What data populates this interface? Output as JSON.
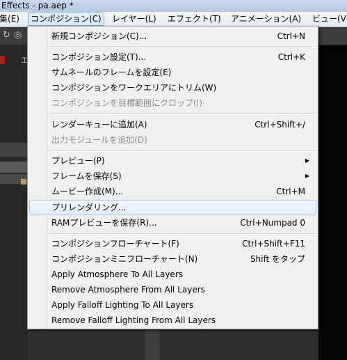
{
  "window": {
    "title": "Effects - pa.aep *"
  },
  "menubar": {
    "items": [
      {
        "label": "編集(E)"
      },
      {
        "label": "コンポジション(C)"
      },
      {
        "label": "レイヤー(L)"
      },
      {
        "label": "エフェクト(T)"
      },
      {
        "label": "アニメーション(A)"
      },
      {
        "label": "ビュー(V)"
      }
    ]
  },
  "background": {
    "panel_tab_label": "エ"
  },
  "menu": {
    "items": [
      {
        "label": "新規コンポジション(C)...",
        "shortcut": "Ctrl+N"
      },
      {
        "label": "コンポジション設定(T)...",
        "shortcut": "Ctrl+K"
      },
      {
        "label": "サムネールのフレームを設定(E)",
        "shortcut": ""
      },
      {
        "label": "コンポジションをワークエリアにトリム(W)",
        "shortcut": ""
      },
      {
        "label": "コンポジションを目標範囲にクロップ(I)",
        "shortcut": "",
        "disabled": true
      },
      {
        "label": "レンダーキューに追加(A)",
        "shortcut": "Ctrl+Shift+/"
      },
      {
        "label": "出力モジュールを追加(D)",
        "shortcut": "",
        "disabled": true
      },
      {
        "label": "プレビュー(P)",
        "shortcut": "",
        "submenu": true
      },
      {
        "label": "フレームを保存(S)",
        "shortcut": "",
        "submenu": true
      },
      {
        "label": "ムービー作成(M)...",
        "shortcut": "Ctrl+M"
      },
      {
        "label": "プリレンダリング...",
        "shortcut": "",
        "highlighted": true
      },
      {
        "label": "RAMプレビューを保存(R)...",
        "shortcut": "Ctrl+Numpad 0"
      },
      {
        "label": "コンポジションフローチャート(F)",
        "shortcut": "Ctrl+Shift+F11"
      },
      {
        "label": "コンポジションミニフローチャート(N)",
        "shortcut": "Shift をタップ"
      },
      {
        "label": "Apply Atmosphere To All Layers",
        "shortcut": ""
      },
      {
        "label": "Remove Atmosphere From All Layers",
        "shortcut": ""
      },
      {
        "label": "Apply Falloff Lighting To All Layers",
        "shortcut": ""
      },
      {
        "label": "Remove Falloff Lighting From All Layers",
        "shortcut": ""
      }
    ]
  },
  "colors": {
    "disabled_text": "#8d8d8d",
    "highlight_border": "#a9c7ec",
    "menu_background": "#f0f0f0"
  }
}
